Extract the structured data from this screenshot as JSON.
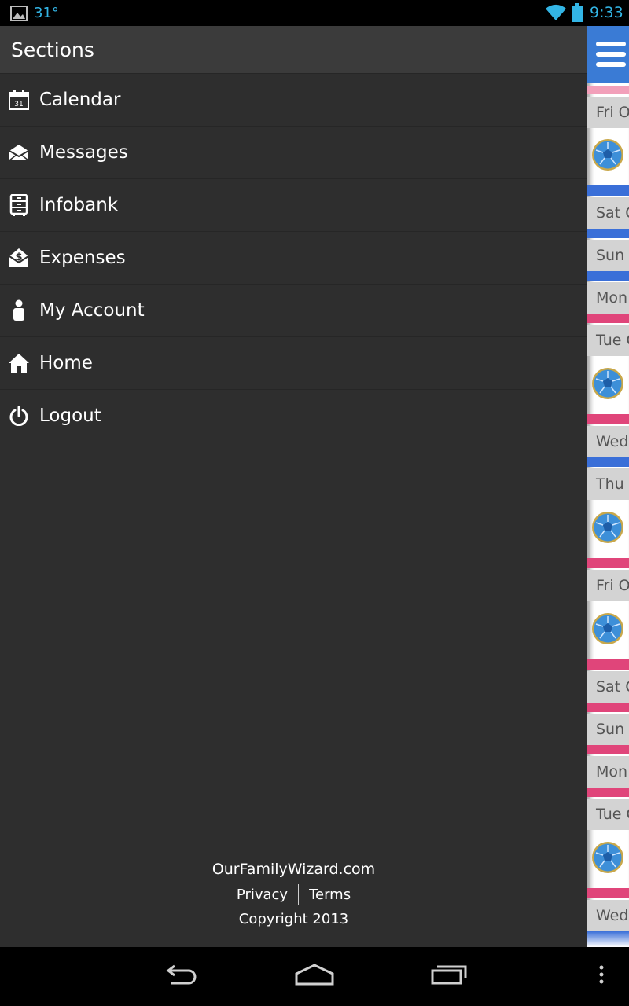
{
  "status_bar": {
    "temperature": "31°",
    "time": "9:33",
    "icons": [
      "gallery-icon",
      "wifi-icon",
      "battery-icon"
    ]
  },
  "drawer": {
    "title": "Sections",
    "items": [
      {
        "label": "Calendar",
        "icon": "calendar-icon"
      },
      {
        "label": "Messages",
        "icon": "envelope-icon"
      },
      {
        "label": "Infobank",
        "icon": "cabinet-icon"
      },
      {
        "label": "Expenses",
        "icon": "money-envelope-icon"
      },
      {
        "label": "My Account",
        "icon": "person-icon"
      },
      {
        "label": "Home",
        "icon": "home-icon"
      },
      {
        "label": "Logout",
        "icon": "power-icon"
      }
    ],
    "footer": {
      "site": "OurFamilyWizard.com",
      "privacy": "Privacy",
      "terms": "Terms",
      "copyright": "Copyright 2013"
    }
  },
  "calendar_peek": {
    "days": [
      "Fri O",
      "Sat O",
      "Sun",
      "Mon",
      "Tue O",
      "Wed",
      "Thu",
      "Fri O",
      "Sat O",
      "Sun",
      "Mon",
      "Tue O",
      "Wed"
    ],
    "colors": {
      "blue": "#3a6fd8",
      "pink": "#e0457a",
      "accent": "#33b5e5"
    }
  }
}
